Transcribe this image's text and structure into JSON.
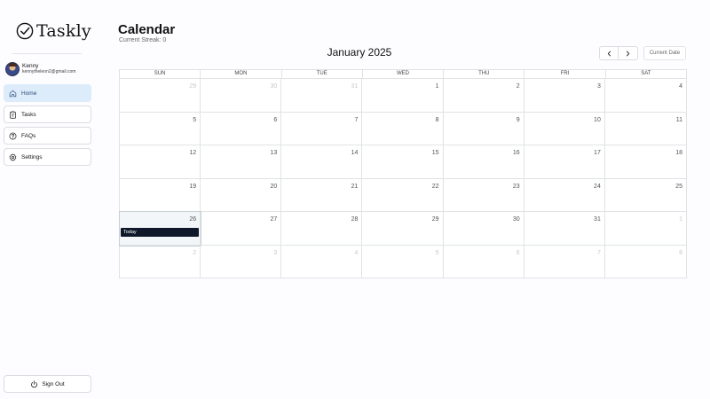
{
  "app": {
    "name": "Taskly"
  },
  "user": {
    "name": "Kenny",
    "email": "kennytheleon2@gmail.com"
  },
  "nav": {
    "home": "Home",
    "tasks": "Tasks",
    "faqs": "FAQs",
    "settings": "Settings",
    "signout": "Sign Out"
  },
  "header": {
    "title": "Calendar",
    "streak": "Current Streak: 0",
    "month": "January 2025",
    "current_date_button": "Current Date"
  },
  "calendar": {
    "weekdays": [
      "SUN",
      "MON",
      "TUE",
      "WED",
      "THU",
      "FRI",
      "SAT"
    ],
    "today_label": "Today",
    "days": [
      {
        "n": "29",
        "other": true
      },
      {
        "n": "30",
        "other": true
      },
      {
        "n": "31",
        "other": true
      },
      {
        "n": "1"
      },
      {
        "n": "2"
      },
      {
        "n": "3"
      },
      {
        "n": "4"
      },
      {
        "n": "5"
      },
      {
        "n": "6"
      },
      {
        "n": "7"
      },
      {
        "n": "8"
      },
      {
        "n": "9"
      },
      {
        "n": "10"
      },
      {
        "n": "11"
      },
      {
        "n": "12"
      },
      {
        "n": "13"
      },
      {
        "n": "14"
      },
      {
        "n": "15"
      },
      {
        "n": "16"
      },
      {
        "n": "17"
      },
      {
        "n": "18"
      },
      {
        "n": "19"
      },
      {
        "n": "20"
      },
      {
        "n": "21"
      },
      {
        "n": "22"
      },
      {
        "n": "23"
      },
      {
        "n": "24"
      },
      {
        "n": "25"
      },
      {
        "n": "26",
        "today": true
      },
      {
        "n": "27"
      },
      {
        "n": "28"
      },
      {
        "n": "29"
      },
      {
        "n": "30"
      },
      {
        "n": "31"
      },
      {
        "n": "1",
        "other": true
      },
      {
        "n": "2",
        "other": true
      },
      {
        "n": "3",
        "other": true
      },
      {
        "n": "4",
        "other": true
      },
      {
        "n": "5",
        "other": true
      },
      {
        "n": "6",
        "other": true
      },
      {
        "n": "7",
        "other": true
      },
      {
        "n": "8",
        "other": true
      }
    ]
  },
  "icons": {
    "logo": "check-circle-icon",
    "home": "home-icon",
    "tasks": "clipboard-icon",
    "faqs": "question-circle-icon",
    "settings": "gear-icon",
    "signout": "power-icon",
    "prev": "chevron-left-icon",
    "next": "chevron-right-icon"
  },
  "colors": {
    "active_nav_bg": "#dcecfb",
    "today_badge": "#0f172a",
    "page_bg": "#fdfcff"
  }
}
